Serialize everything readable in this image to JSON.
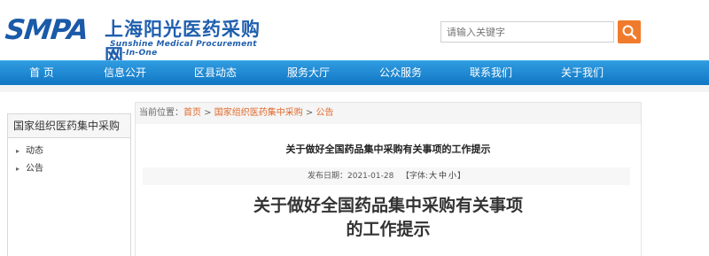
{
  "header": {
    "logo_main": "SMPA",
    "logo_cn": "上海阳光医药采购网",
    "logo_en": "Sunshine Medical Procurement All-In-One",
    "search_placeholder": "请输入关键字",
    "search_icon": "search-icon",
    "brand_color": "#1a5aa8",
    "search_button_color": "#f07b2c"
  },
  "nav": {
    "color": "#1b88d6",
    "items": [
      "首 页",
      "信息公开",
      "区县动态",
      "服务大厅",
      "公众服务",
      "联系我们",
      "关于我们"
    ]
  },
  "sidebar": {
    "title": "国家组织医药集中采购",
    "items": [
      "动态",
      "公告"
    ]
  },
  "breadcrumb": {
    "prefix": "当前位置：",
    "home": "首页",
    "sep1": " > ",
    "section": "国家组织医药集中采购",
    "sep2": " > ",
    "current": "公告"
  },
  "article": {
    "title_small": "关于做好全国药品集中采购有关事项的工作提示",
    "publish_label": "发布日期：",
    "publish_date": "2021-01-28",
    "font_label_open": "【字体:",
    "font_large": "大",
    "font_medium": "中",
    "font_small": "小",
    "font_label_close": "】",
    "title_big_line1": "关于做好全国药品集中采购有关事项",
    "title_big_line2": "的工作提示"
  }
}
